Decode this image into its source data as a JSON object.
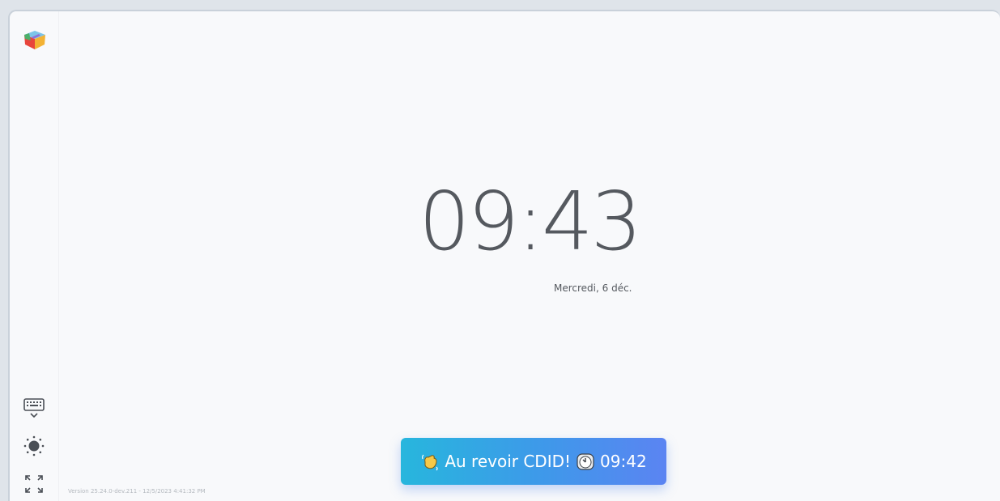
{
  "clock": {
    "time": "09:43",
    "date": "Mercredi, 6 déc."
  },
  "sidebar": {
    "logo_icon": "cube-logo-icon",
    "buttons": [
      {
        "name": "keyboard-button",
        "icon": "keyboard-icon"
      },
      {
        "name": "brightness-button",
        "icon": "sun-icon"
      },
      {
        "name": "fullscreen-button",
        "icon": "fullscreen-icon"
      }
    ]
  },
  "toast": {
    "wave_icon": "waving-hand-icon",
    "message": "Au revoir CDID!",
    "clock_icon": "clock-icon",
    "time": "09:42"
  },
  "footer": {
    "version": "Version 25.24.0-dev.211 - 12/5/2023 4:41:32 PM"
  },
  "colors": {
    "background": "#f8f9fb",
    "clock_text": "#55595f",
    "toast_gradient_start": "#27b6dd",
    "toast_gradient_end": "#5b84f2"
  }
}
